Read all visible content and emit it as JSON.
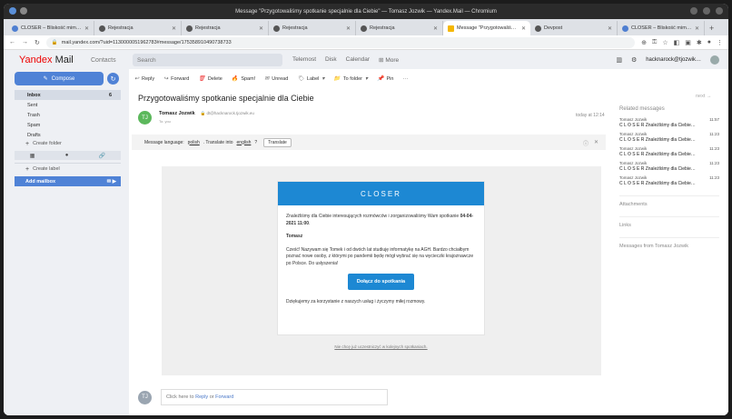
{
  "window": {
    "title": "Message \"Przygotowaliśmy spotkanie specjalnie dla Ciebie\" — Tomasz Jozwik — Yandex.Mail — Chromium"
  },
  "tabs": [
    {
      "label": "CLOSER – Bliskość mimo o…",
      "active": false
    },
    {
      "label": "Rejestracja",
      "active": false
    },
    {
      "label": "Rejestracja",
      "active": false
    },
    {
      "label": "Rejestracja",
      "active": false
    },
    {
      "label": "Rejestracja",
      "active": false
    },
    {
      "label": "Message \"Przygotowaliśm…",
      "active": true
    },
    {
      "label": "Devpost",
      "active": false
    },
    {
      "label": "CLOSER – Bliskość mimo o…",
      "active": false
    }
  ],
  "address": {
    "url": "mail.yandex.com/?uid=1130000051962783#message/175358910490738733"
  },
  "sidebar": {
    "logo_main": "Yandex",
    "logo_sub": "Mail",
    "contacts": "Contacts",
    "compose": "Compose",
    "folders": [
      {
        "label": "Inbox",
        "count": "6"
      },
      {
        "label": "Sent",
        "count": ""
      },
      {
        "label": "Trash",
        "count": ""
      },
      {
        "label": "Spam",
        "count": ""
      },
      {
        "label": "Drafts",
        "count": ""
      }
    ],
    "create_folder": "Create folder",
    "create_label": "Create label",
    "add_mailbox": "Add mailbox"
  },
  "topbar": {
    "search_placeholder": "Search",
    "links": [
      "Telemost",
      "Disk",
      "Calendar",
      "More"
    ],
    "username": "hacknarock@tjozwik…"
  },
  "toolbar": {
    "reply": "Reply",
    "forward": "Forward",
    "delete": "Delete",
    "spam": "Spam!",
    "unread": "Unread",
    "label": "Label",
    "to_folder": "To folder",
    "pin": "Pin"
  },
  "message": {
    "subject": "Przygotowaliśmy spotkanie specjalnie dla Ciebie",
    "sender_initials": "TJ",
    "sender_name": "Tomasz Jozwik",
    "sender_email": "dt@hacknarock.tjozwik.eu",
    "to": "To: you",
    "date": "today at 12:14",
    "lang_text": "Message language:",
    "lang_from": "polish",
    "lang_mid": ". Translate into",
    "lang_to": "english",
    "lang_q": "?",
    "translate": "Translate",
    "brand": "CLOSER",
    "intro": "Znaleźliśmy dla Ciebie interesujących rozmówców i zorganizowaliśmy Wam spotkanie",
    "meeting_time": "04-04-2021 11:00",
    "greeting_name": "Tomasz",
    "bio": "Cześć! Nazywam się Tomek i od dwóch lat studiuję informatykę na AGH. Bardzo chciałbym poznać nowe osoby, z którymi po pandemii będę mógł wybrać się na wycieczki krajoznawcze po Polsce. Do usłyszenia!",
    "cta": "Dołącz do spotkania",
    "thanks": "Dziękujemy za korzystanie z naszych usług i życzymy miłej rozmowy.",
    "unsubscribe": "Nie chcę już uczestniczyć w kolejnych spotkaniach.",
    "reply_prompt": "Click here to",
    "reply_link": "Reply",
    "reply_or": "or",
    "forward_link": "Forward",
    "reply_initials": "TJ"
  },
  "right": {
    "next": "next",
    "related_title": "Related messages",
    "related": [
      {
        "from": "Tomasz Jozwik",
        "time": "11:57",
        "subject": "C L O S E R Znaleźliśmy dla Ciebie…"
      },
      {
        "from": "Tomasz Jozwik",
        "time": "11:23",
        "subject": "C L O S E R Znaleźliśmy dla Ciebie…"
      },
      {
        "from": "Tomasz Jozwik",
        "time": "11:23",
        "subject": "C L O S E R Znaleźliśmy dla Ciebie…"
      },
      {
        "from": "Tomasz Jozwik",
        "time": "11:23",
        "subject": "C L O S E R Znaleźliśmy dla Ciebie…"
      },
      {
        "from": "Tomasz Jozwik",
        "time": "11:23",
        "subject": "C L O S E R Znaleźliśmy dla Ciebie…"
      }
    ],
    "attachments": "Attachments",
    "links": "Links",
    "messages_from": "Messages from Tomasz Jozwik"
  }
}
